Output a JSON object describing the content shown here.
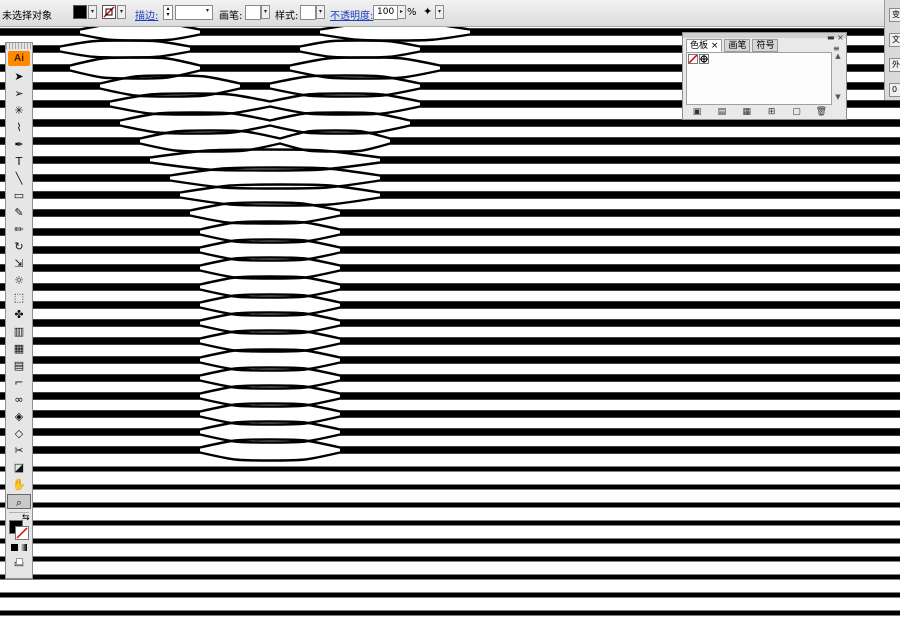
{
  "control_bar": {
    "status": "未选择对象",
    "fill_color": "#000000",
    "stroke_label": "描边:",
    "stroke_weight": "",
    "brush_label": "画笔:",
    "style_label": "样式:",
    "opacity_label": "不透明度:",
    "opacity_value": "100",
    "opacity_unit": "%",
    "arrow_glyph": "▾",
    "spin_glyph": "▸"
  },
  "toolbox": {
    "logo": "Ai",
    "tools": [
      {
        "name": "selection-tool-icon",
        "glyph": "➤"
      },
      {
        "name": "direct-selection-tool-icon",
        "glyph": "➢"
      },
      {
        "name": "magic-wand-tool-icon",
        "glyph": "✳"
      },
      {
        "name": "lasso-tool-icon",
        "glyph": "⌇"
      },
      {
        "name": "pen-tool-icon",
        "glyph": "✒"
      },
      {
        "name": "type-tool-icon",
        "glyph": "T"
      },
      {
        "name": "line-tool-icon",
        "glyph": "╲"
      },
      {
        "name": "rectangle-tool-icon",
        "glyph": "▭"
      },
      {
        "name": "paintbrush-tool-icon",
        "glyph": "✎"
      },
      {
        "name": "pencil-tool-icon",
        "glyph": "✏"
      },
      {
        "name": "rotate-tool-icon",
        "glyph": "↻"
      },
      {
        "name": "scale-tool-icon",
        "glyph": "⇲"
      },
      {
        "name": "warp-tool-icon",
        "glyph": "☼"
      },
      {
        "name": "free-transform-tool-icon",
        "glyph": "⬚"
      },
      {
        "name": "symbol-sprayer-tool-icon",
        "glyph": "✤"
      },
      {
        "name": "column-graph-tool-icon",
        "glyph": "▥"
      },
      {
        "name": "mesh-tool-icon",
        "glyph": "▦"
      },
      {
        "name": "gradient-tool-icon",
        "glyph": "▤"
      },
      {
        "name": "eyedropper-tool-icon",
        "glyph": "⌐"
      },
      {
        "name": "blend-tool-icon",
        "glyph": "∞"
      },
      {
        "name": "live-paint-bucket-tool-icon",
        "glyph": "◈"
      },
      {
        "name": "live-paint-selection-tool-icon",
        "glyph": "◇"
      },
      {
        "name": "slice-tool-icon",
        "glyph": "✂"
      },
      {
        "name": "eraser-tool-icon",
        "glyph": "◪"
      },
      {
        "name": "hand-tool-icon",
        "glyph": "✋"
      },
      {
        "name": "zoom-tool-icon",
        "glyph": "⌕"
      }
    ],
    "swap_glyph": "⇆",
    "screen_mode_glyph": "▭"
  },
  "swatches_panel": {
    "tabs": [
      "色板",
      "画笔",
      "符号"
    ],
    "close_glyph": "×",
    "collapse_glyph": "◂◂",
    "menu_glyph": "≡",
    "scroll_up": "▲",
    "scroll_down": "▼",
    "bottom_icons": [
      "▣",
      "▤",
      "▦",
      "⊞",
      "▢",
      "🗑"
    ]
  },
  "right_dock": {
    "items": [
      "变",
      "文",
      "外",
      "0"
    ]
  },
  "colors": {
    "line": "#000000",
    "background": "#ffffff",
    "toolbar": "#e6e6e6",
    "logo": "#ff8a00"
  }
}
